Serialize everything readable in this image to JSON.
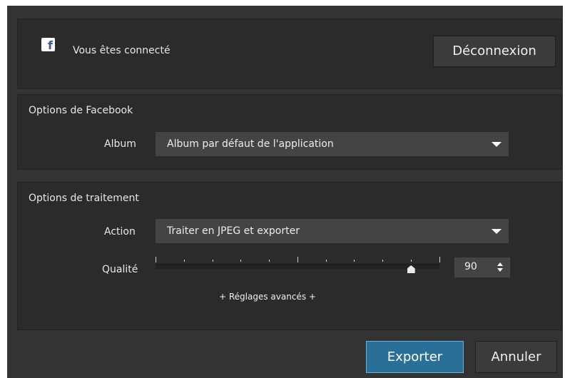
{
  "account": {
    "status_text": "Vous êtes connecté",
    "logout_label": "Déconnexion",
    "brand_icon": "facebook-icon"
  },
  "facebook_options": {
    "title": "Options de Facebook",
    "album_label": "Album",
    "album_value": "Album par défaut de l'application"
  },
  "processing_options": {
    "title": "Options de traitement",
    "action_label": "Action",
    "action_value": "Traiter en JPEG et exporter",
    "quality_label": "Qualité",
    "quality_value": "90",
    "quality_level": 0.9,
    "advanced_link": "+ Réglages avancés +"
  },
  "footer": {
    "export_label": "Exporter",
    "cancel_label": "Annuler"
  },
  "colors": {
    "dialog_bg": "#333333",
    "panel_bg": "#2b2b2b",
    "primary_button": "#2a6f98",
    "primary_border": "#5fb4e2",
    "facebook_blue": "#3b5998"
  }
}
